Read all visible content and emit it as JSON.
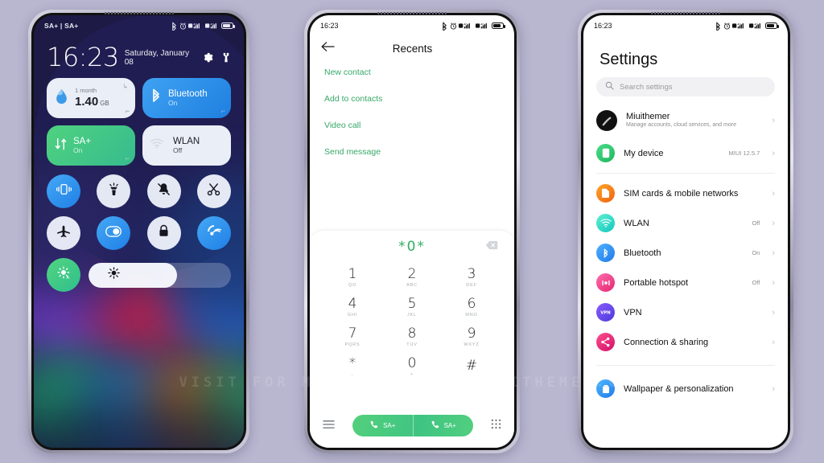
{
  "watermark": "VISIT FOR MORE THEMES - MIUITHEMER.COM",
  "phone1": {
    "name": "control-center",
    "status": {
      "carrier": "SA+ | SA+",
      "time": "16:23"
    },
    "clock": {
      "time": "16:23",
      "date": "Saturday, January 08"
    },
    "tiles": [
      {
        "title": "1 month",
        "value": "1.40",
        "unit": "GB",
        "style": "light",
        "icon": "data-usage-icon"
      },
      {
        "title": "Bluetooth",
        "state": "On",
        "style": "blue",
        "icon": "bluetooth-icon"
      },
      {
        "title": "SA+",
        "state": "On",
        "style": "green",
        "icon": "data-transfer-icon"
      },
      {
        "title": "WLAN",
        "state": "Off",
        "style": "light",
        "icon": "wifi-icon"
      }
    ],
    "toggles_row1": [
      {
        "icon": "vibrate-icon",
        "state": "on"
      },
      {
        "icon": "flashlight-icon",
        "state": "off"
      },
      {
        "icon": "mute-icon",
        "state": "off"
      },
      {
        "icon": "scissors-icon",
        "state": "off"
      }
    ],
    "toggles_row2": [
      {
        "icon": "airplane-icon",
        "state": "off"
      },
      {
        "icon": "dark-mode-icon",
        "state": "on"
      },
      {
        "icon": "lock-icon",
        "state": "off"
      },
      {
        "icon": "cast-icon",
        "state": "on"
      }
    ],
    "brightness": {
      "icon": "auto-brightness-icon",
      "slider_icon": "brightness-icon",
      "level": 62
    }
  },
  "phone2": {
    "name": "dialer",
    "status": {
      "time": "16:23"
    },
    "header": {
      "back": "back-arrow-icon",
      "title": "Recents"
    },
    "actions": [
      "New contact",
      "Add to contacts",
      "Video call",
      "Send message"
    ],
    "number": "*0*",
    "keypad": [
      {
        "digit": "1",
        "letters": "QO"
      },
      {
        "digit": "2",
        "letters": "ABC"
      },
      {
        "digit": "3",
        "letters": "DEF"
      },
      {
        "digit": "4",
        "letters": "GHI"
      },
      {
        "digit": "5",
        "letters": "JKL"
      },
      {
        "digit": "6",
        "letters": "MNO"
      },
      {
        "digit": "7",
        "letters": "PQRS"
      },
      {
        "digit": "8",
        "letters": "TUV"
      },
      {
        "digit": "9",
        "letters": "WXYZ"
      },
      {
        "digit": "*",
        "letters": ","
      },
      {
        "digit": "0",
        "letters": "+"
      },
      {
        "digit": "#",
        "letters": ""
      }
    ],
    "bottom": {
      "menu_icon": "menu-icon",
      "call_buttons": [
        {
          "label": "SA+",
          "icon": "call-icon"
        },
        {
          "label": "SA+",
          "icon": "call-icon"
        }
      ],
      "keypad_icon": "keypad-icon"
    }
  },
  "phone3": {
    "name": "settings",
    "status": {
      "time": "16:23"
    },
    "title": "Settings",
    "search": {
      "placeholder": "Search settings",
      "icon": "search-icon"
    },
    "account": {
      "name": "Miuithemer",
      "sub": "Manage accounts, cloud services, and more",
      "icon": "avatar-icon",
      "color": "#111111"
    },
    "items_group1": [
      {
        "label": "My device",
        "value": "MIUI 12.5.7",
        "icon": "device-icon",
        "color": "#2fc96a"
      }
    ],
    "items_group2": [
      {
        "label": "SIM cards & mobile networks",
        "value": "",
        "icon": "sim-icon",
        "color": "#f47b1b"
      },
      {
        "label": "WLAN",
        "value": "Off",
        "icon": "wifi-icon",
        "color": "#2bd3c0"
      },
      {
        "label": "Bluetooth",
        "value": "On",
        "icon": "bluetooth-icon",
        "color": "#2f91f2"
      },
      {
        "label": "Portable hotspot",
        "value": "Off",
        "icon": "hotspot-icon",
        "color": "#ef3f7e"
      },
      {
        "label": "VPN",
        "value": "",
        "icon": "vpn-icon",
        "color": "#6b4fe0"
      },
      {
        "label": "Connection & sharing",
        "value": "",
        "icon": "share-icon",
        "color": "#ee2f74"
      }
    ],
    "items_group3": [
      {
        "label": "Wallpaper & personalization",
        "value": "",
        "icon": "wallpaper-icon",
        "color": "#2f9cf0"
      }
    ],
    "chevron": "›"
  }
}
